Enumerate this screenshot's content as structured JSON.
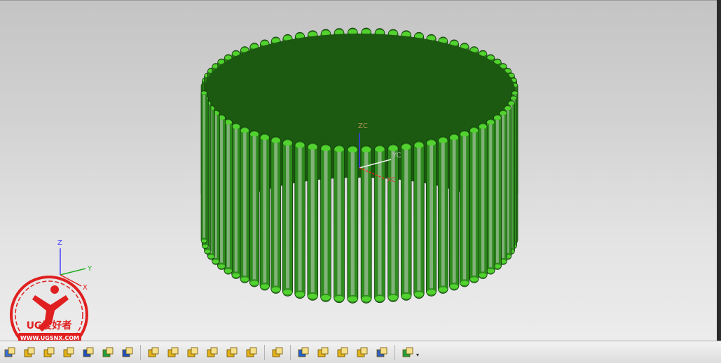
{
  "viewport": {
    "background_top": "#c4c4c4",
    "background_bottom": "#ececec",
    "model_color": "#2e8b1e",
    "model_highlight": "#52d22f",
    "model_shadow": "#1b5a10"
  },
  "wcs": {
    "zc_label": "ZC",
    "yc_label": "YC",
    "xc_label": "XC"
  },
  "triad": {
    "z_label": "Z",
    "y_label": "Y",
    "x_label": "X"
  },
  "logo": {
    "brand": "UG爱好者",
    "url": "WWW.UGSNX.COM",
    "color": "#e02020"
  },
  "toolbar": {
    "buttons": [
      "plus-icon",
      "cube-stack-icon",
      "cube-copy-icon",
      "cube-move-icon",
      "mirror-icon",
      "split-icon",
      "edit-icon",
      "assembly-icon",
      "assembly-add-icon",
      "constraint-icon",
      "reposition-icon",
      "component-array-icon",
      "explode-icon",
      "part-navigator-icon",
      "sequence-icon",
      "link-icon",
      "info-icon",
      "clearance-icon",
      "wave-icon",
      "sort-icon"
    ]
  }
}
